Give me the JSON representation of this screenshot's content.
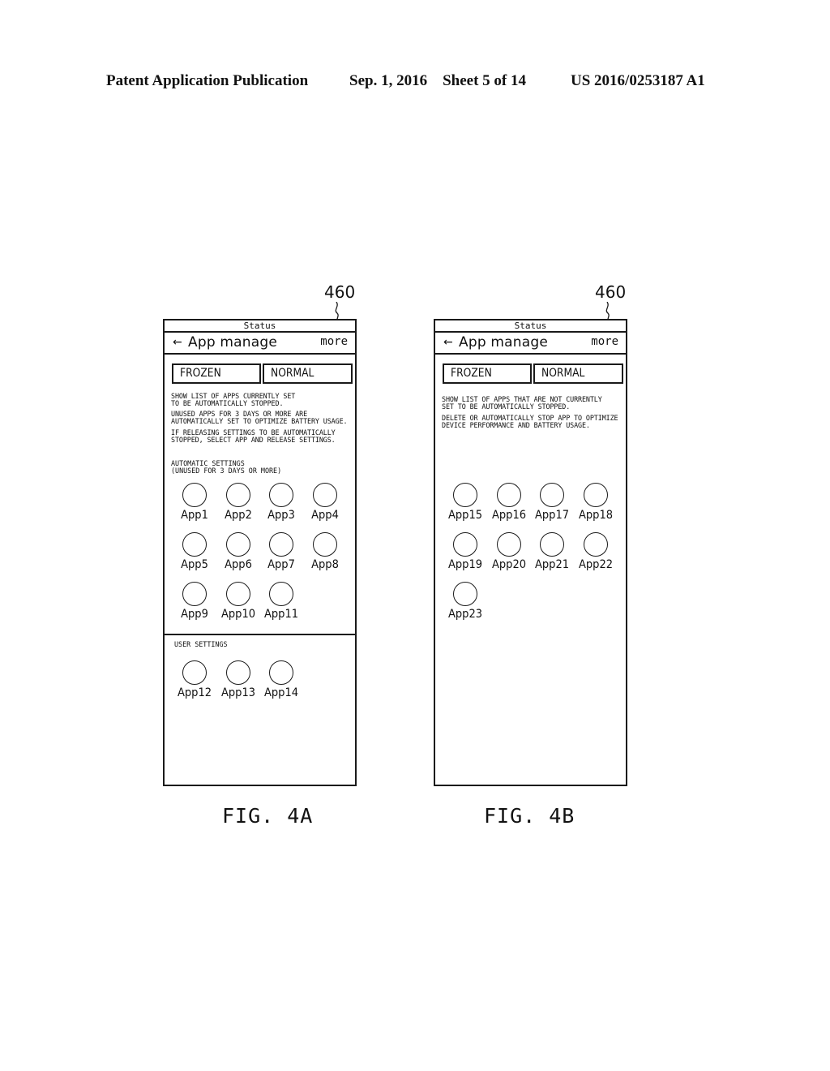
{
  "header": {
    "publication": "Patent Application Publication",
    "date_sheet": "Sep. 1, 2016    Sheet 5 of 14",
    "patent_number": "US 2016/0253187 A1"
  },
  "figures": [
    {
      "reference_numeral": "460",
      "caption": "FIG. 4A",
      "screen": {
        "status_bar": "Status",
        "back_icon": "←",
        "title": "App manage",
        "more_label": "more",
        "tabs": [
          {
            "label": "FROZEN",
            "selected": true
          },
          {
            "label": "NORMAL",
            "selected": false
          }
        ],
        "descriptions": [
          "SHOW LIST OF APPS CURRENTLY SET\nTO BE AUTOMATICALLY STOPPED.",
          "UNUSED APPS FOR 3 DAYS OR MORE ARE\nAUTOMATICALLY SET TO OPTIMIZE BATTERY USAGE.",
          "IF RELEASING SETTINGS TO BE AUTOMATICALLY\nSTOPPED, SELECT APP AND RELEASE SETTINGS."
        ],
        "sections": [
          {
            "label": "AUTOMATIC SETTINGS\n(UNUSED FOR 3 DAYS OR MORE)",
            "apps": [
              "App1",
              "App2",
              "App3",
              "App4",
              "App5",
              "App6",
              "App7",
              "App8",
              "App9",
              "App10",
              "App11"
            ]
          },
          {
            "label": "USER SETTINGS",
            "apps": [
              "App12",
              "App13",
              "App14"
            ]
          }
        ]
      }
    },
    {
      "reference_numeral": "460",
      "caption": "FIG. 4B",
      "screen": {
        "status_bar": "Status",
        "back_icon": "←",
        "title": "App manage",
        "more_label": "more",
        "tabs": [
          {
            "label": "FROZEN",
            "selected": false
          },
          {
            "label": "NORMAL",
            "selected": true
          }
        ],
        "descriptions": [
          "SHOW LIST OF APPS THAT ARE NOT CURRENTLY\nSET TO BE AUTOMATICALLY STOPPED.",
          "DELETE OR AUTOMATICALLY STOP APP TO OPTIMIZE\nDEVICE PERFORMANCE AND BATTERY USAGE."
        ],
        "sections": [
          {
            "label": "",
            "apps": [
              "App15",
              "App16",
              "App17",
              "App18",
              "App19",
              "App20",
              "App21",
              "App22",
              "App23"
            ]
          }
        ]
      }
    }
  ]
}
